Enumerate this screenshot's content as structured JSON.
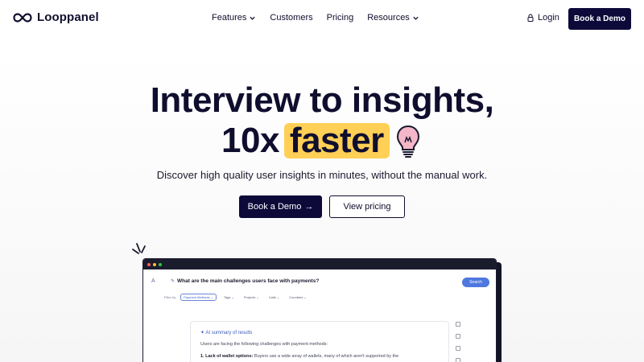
{
  "brand": {
    "name": "Looppanel"
  },
  "nav": {
    "items": [
      {
        "label": "Features",
        "dropdown": true
      },
      {
        "label": "Customers",
        "dropdown": false
      },
      {
        "label": "Pricing",
        "dropdown": false
      },
      {
        "label": "Resources",
        "dropdown": true
      }
    ],
    "login": "Login",
    "cta": "Book a Demo"
  },
  "hero": {
    "line1": "Interview to insights,",
    "line2_prefix": "10x",
    "line2_highlight": "faster",
    "subtitle": "Discover high quality user insights in minutes, without the manual work.",
    "primary_button": "Book a Demo",
    "primary_arrow": "→",
    "secondary_button": "View pricing"
  },
  "app": {
    "avatar": "A",
    "question_icon": "✎",
    "question": "What are the main challenges users face with payments?",
    "search_label": "Search",
    "filters": {
      "label": "Filter by",
      "chips": [
        "Payment Methods ⌄",
        "Tags ⌄",
        "Projects ⌄",
        "Calls ⌄",
        "Countries ⌄"
      ]
    },
    "summary": {
      "title": "✦ AI summary of results",
      "intro": "Users are facing the following challenges with payment methods:",
      "item1_bold": "1. Lack of wallet options:",
      "item1_text": " Buyers use a wide array of wallets, many of which aren't supported by the"
    }
  },
  "colors": {
    "navy": "#0d0a3a",
    "highlight": "#ffcf56",
    "search_blue": "#4f78df"
  },
  "icons": [
    "infinity-logo-icon",
    "chevron-down-icon",
    "lock-icon",
    "lightbulb-icon",
    "sparkle-lines-icon"
  ]
}
